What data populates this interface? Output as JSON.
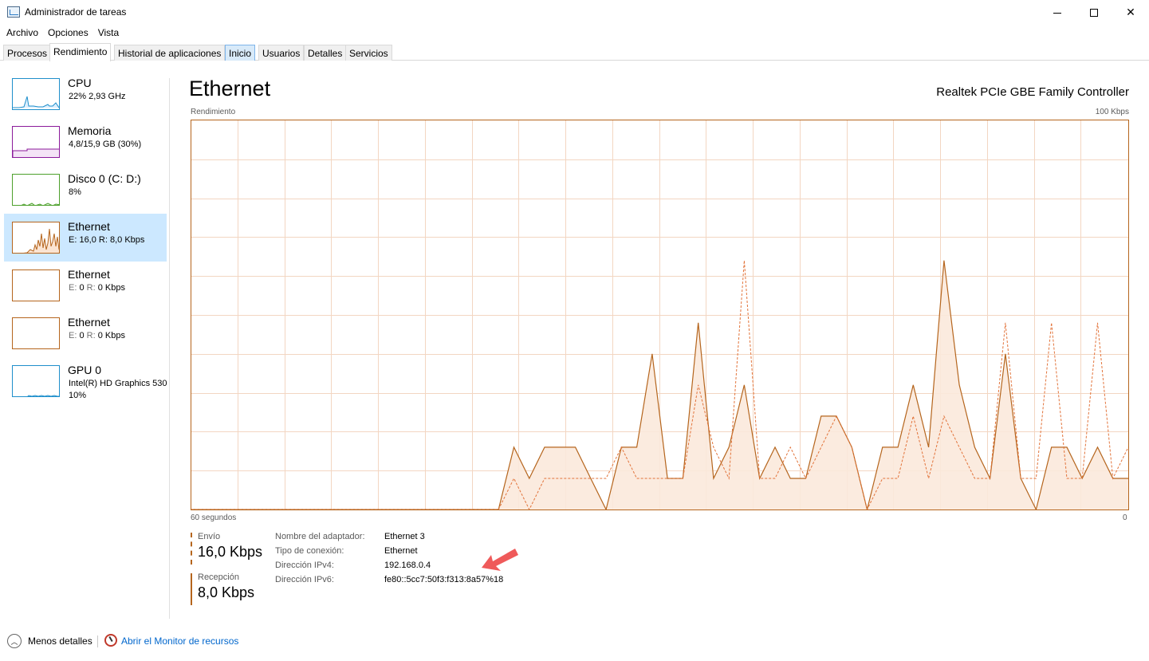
{
  "window": {
    "title": "Administrador de tareas"
  },
  "menu": [
    "Archivo",
    "Opciones",
    "Vista"
  ],
  "tabs": [
    {
      "label": "Procesos"
    },
    {
      "label": "Rendimiento"
    },
    {
      "label": "Historial de aplicaciones"
    },
    {
      "label": "Inicio"
    },
    {
      "label": "Usuarios"
    },
    {
      "label": "Detalles"
    },
    {
      "label": "Servicios"
    }
  ],
  "sidebar": {
    "items": [
      {
        "name": "CPU",
        "sub": "22%  2,93 GHz",
        "color": "#1f8fcb"
      },
      {
        "name": "Memoria",
        "sub": "4,8/15,9 GB (30%)",
        "color": "#8b1a9b"
      },
      {
        "name": "Disco 0 (C: D:)",
        "sub": "8%",
        "color": "#4da02c"
      },
      {
        "name": "Ethernet",
        "sub": "E: 16,0  R: 8,0 Kbps",
        "color": "#b5651d"
      },
      {
        "name": "Ethernet",
        "sub_e": "E:",
        "sub_e_val": "0",
        "sub_r": "R:",
        "sub_r_val": "0 Kbps",
        "color": "#b5651d"
      },
      {
        "name": "Ethernet",
        "sub_e": "E:",
        "sub_e_val": "0",
        "sub_r": "R:",
        "sub_r_val": "0 Kbps",
        "color": "#b5651d"
      },
      {
        "name": "GPU 0",
        "sub": "Intel(R) HD Graphics 530",
        "sub2": "10%",
        "color": "#1f8fcb"
      }
    ]
  },
  "main": {
    "title": "Ethernet",
    "device": "Realtek PCIe GBE Family Controller",
    "graph_label_left": "Rendimiento",
    "graph_label_right": "100 Kbps",
    "graph_bottom_left": "60 segundos",
    "graph_bottom_right": "0",
    "accent": "#b5651d"
  },
  "stats": {
    "send_label": "Envío",
    "send_value": "16,0 Kbps",
    "recv_label": "Recepción",
    "recv_value": "8,0 Kbps"
  },
  "info": [
    {
      "key": "Nombre del adaptador:",
      "value": "Ethernet 3"
    },
    {
      "key": "Tipo de conexión:",
      "value": "Ethernet"
    },
    {
      "key": "Dirección IPv4:",
      "value": "192.168.0.4"
    },
    {
      "key": "Dirección IPv6:",
      "value": "fe80::5cc7:50f3:f313:8a57%18"
    }
  ],
  "footer": {
    "less_details": "Menos detalles",
    "resource_monitor": "Abrir el Monitor de recursos"
  },
  "chart_data": {
    "type": "area",
    "ylim": [
      0,
      100
    ],
    "series": [
      {
        "values": [
          0,
          0,
          0,
          0,
          0,
          0,
          0,
          0,
          0,
          0,
          0,
          0,
          0,
          0,
          0,
          0,
          0,
          0,
          0,
          0,
          0,
          16,
          8,
          16,
          16,
          16,
          8,
          0,
          16,
          16,
          40,
          8,
          8,
          48,
          8,
          16,
          32,
          8,
          16,
          8,
          8,
          24,
          24,
          16,
          0,
          16,
          16,
          32,
          16,
          64,
          32,
          16,
          8,
          40,
          8,
          0,
          16,
          16,
          8,
          16,
          8,
          8
        ]
      },
      {
        "values": [
          0,
          0,
          0,
          0,
          0,
          0,
          0,
          0,
          0,
          0,
          0,
          0,
          0,
          0,
          0,
          0,
          0,
          0,
          0,
          0,
          0,
          8,
          0,
          8,
          8,
          8,
          8,
          8,
          16,
          8,
          8,
          8,
          8,
          32,
          16,
          8,
          64,
          8,
          8,
          16,
          8,
          16,
          24,
          16,
          0,
          8,
          8,
          24,
          8,
          24,
          16,
          8,
          8,
          48,
          8,
          8,
          48,
          8,
          8,
          48,
          8,
          16
        ]
      }
    ]
  }
}
